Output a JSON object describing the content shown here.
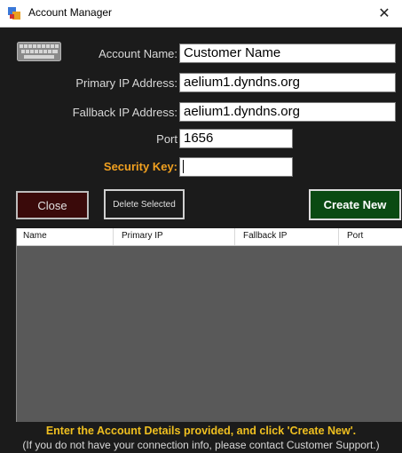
{
  "window": {
    "title": "Account Manager",
    "close_glyph": "✕",
    "icon": "app-icon"
  },
  "form": {
    "account_name": {
      "label": "Account Name:",
      "value": "Customer Name"
    },
    "primary_ip": {
      "label": "Primary IP Address:",
      "value": "aelium1.dyndns.org"
    },
    "fallback_ip": {
      "label": "Fallback IP Address:",
      "value": "aelium1.dyndns.org"
    },
    "port": {
      "label": "Port",
      "value": "1656"
    },
    "security_key": {
      "label": "Security Key:",
      "value": ""
    }
  },
  "buttons": {
    "close": "Close",
    "delete": "Delete Selected",
    "create": "Create New"
  },
  "table": {
    "columns": [
      "Name",
      "Primary IP",
      "Fallback IP",
      "Port"
    ],
    "rows": []
  },
  "footer": {
    "line1": "Enter the Account Details provided, and click 'Create New'.",
    "line2": "(If you do not have your connection info, please contact Customer Support.)"
  },
  "colors": {
    "background": "#1b1b1b",
    "accent_orange": "#f0a020",
    "accent_yellow": "#f0c020",
    "close_button": "#3a0a0a",
    "create_button": "#0a4a12",
    "grid_body": "#595959"
  }
}
